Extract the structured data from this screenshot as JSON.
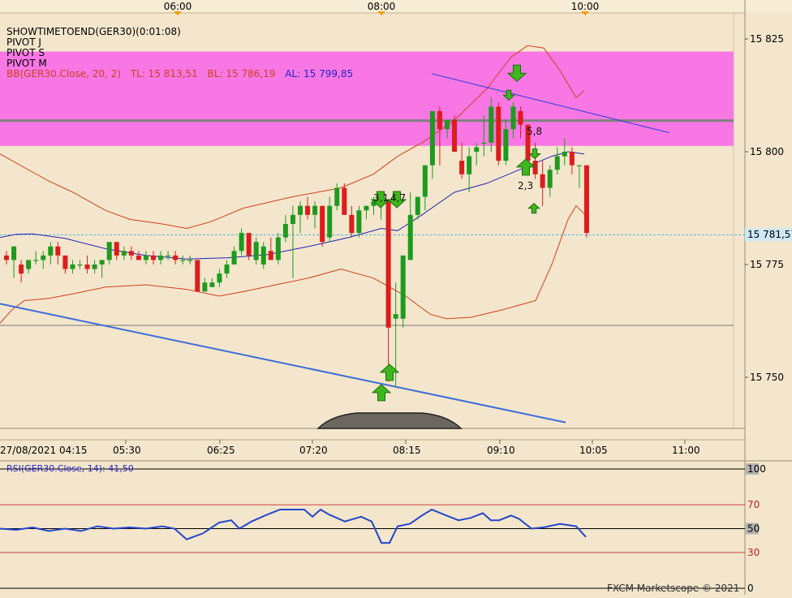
{
  "chart_data": {
    "type": "candlestick",
    "symbol": "GER30",
    "legend": [
      {
        "text": "SHOWTIMETOEND(GER30)(0:01:08)",
        "color": "#000000"
      },
      {
        "text": "PIVOT J",
        "color": "#000000"
      },
      {
        "text": "PIVOT S",
        "color": "#000000"
      },
      {
        "text": "PIVOT M",
        "color": "#000000"
      }
    ],
    "bb_legend": {
      "prefix": "BB(GER30.Close, 20, 2)",
      "tl": "TL: 15 813,51",
      "bl": "BL: 15 786,19",
      "al": "AL: 15 799,85"
    },
    "top_time_labels": [
      "06:00",
      "08:00",
      "10:00"
    ],
    "x_tick_labels": [
      "27/08/2021 04:15",
      "05:30",
      "06:25",
      "07:20",
      "08:15",
      "09:10",
      "10:05",
      "11:00"
    ],
    "y_tick_labels": [
      "15 825",
      "15 800",
      "15 775",
      "15 750"
    ],
    "y_ticks": [
      15825,
      15800,
      15775,
      15750
    ],
    "ylim": [
      15735.3,
      15832.5
    ],
    "current_price_label": "15 781,57",
    "current_price": 15781.57,
    "pivot_zone": {
      "low": 15801.3,
      "high": 15822.2,
      "line": 15806.9,
      "color": "#f877e4"
    },
    "horizontal_line": 15761.5,
    "annotations": [
      "3,1",
      "4,7",
      "5,8",
      "2,3"
    ],
    "candles": [
      [
        15777,
        15778,
        15775,
        15776
      ],
      [
        15776,
        15779,
        15772,
        15779
      ],
      [
        15775,
        15776,
        15771,
        15773
      ],
      [
        15774,
        15776,
        15773,
        15776
      ],
      [
        15776,
        15778,
        15775,
        15776
      ],
      [
        15776,
        15778,
        15774,
        15777
      ],
      [
        15777,
        15780,
        15775,
        15779
      ],
      [
        15779,
        15780,
        15775,
        15777
      ],
      [
        15777,
        15777,
        15773,
        15774
      ],
      [
        15774,
        15776,
        15773,
        15775
      ],
      [
        15775,
        15776,
        15774,
        15775
      ],
      [
        15775,
        15777,
        15773,
        15774
      ],
      [
        15774,
        15776,
        15773,
        15775
      ],
      [
        15775,
        15776,
        15772,
        15776
      ],
      [
        15776,
        15780,
        15775,
        15780
      ],
      [
        15780,
        15780,
        15776,
        15777
      ],
      [
        15777,
        15779,
        15776,
        15778
      ],
      [
        15778,
        15779,
        15776,
        15777
      ],
      [
        15777,
        15778,
        15776,
        15776
      ],
      [
        15776,
        15778,
        15775,
        15777
      ],
      [
        15777,
        15778,
        15775,
        15776
      ],
      [
        15776,
        15778,
        15775,
        15777
      ],
      [
        15777,
        15778,
        15776,
        15777
      ],
      [
        15777,
        15778,
        15775,
        15776
      ],
      [
        15776,
        15777,
        15775,
        15776
      ],
      [
        15776,
        15777,
        15775,
        15776
      ],
      [
        15776,
        15776,
        15769,
        15769
      ],
      [
        15769,
        15772,
        15769,
        15771
      ],
      [
        15770,
        15772,
        15770,
        15771
      ],
      [
        15771,
        15774,
        15770,
        15773
      ],
      [
        15773,
        15776,
        15772,
        15775
      ],
      [
        15775,
        15779,
        15775,
        15778
      ],
      [
        15778,
        15783,
        15777,
        15782
      ],
      [
        15782,
        15782,
        15776,
        15777
      ],
      [
        15776,
        15781,
        15775,
        15780
      ],
      [
        15775,
        15780,
        15774,
        15779
      ],
      [
        15778,
        15781,
        15776,
        15776
      ],
      [
        15776,
        15782,
        15775,
        15781
      ],
      [
        15781,
        15786,
        15780,
        15784
      ],
      [
        15784,
        15788,
        15772,
        15786
      ],
      [
        15786,
        15789,
        15782,
        15788
      ],
      [
        15788,
        15790,
        15785,
        15786
      ],
      [
        15786,
        15789,
        15783,
        15788
      ],
      [
        15788,
        15788,
        15779,
        15780
      ],
      [
        15781,
        15790,
        15780,
        15788
      ],
      [
        15788,
        15793,
        15787,
        15792
      ],
      [
        15792,
        15793,
        15786,
        15786
      ],
      [
        15786,
        15788,
        15781,
        15782
      ],
      [
        15782,
        15788,
        15781,
        15787
      ],
      [
        15787,
        15788,
        15785,
        15788
      ],
      [
        15788,
        15790,
        15786,
        15789
      ],
      [
        15789,
        15791,
        15785,
        15789
      ],
      [
        15789,
        15789,
        15749,
        15761
      ],
      [
        15763,
        15771,
        15748,
        15764
      ],
      [
        15763,
        15774,
        15761,
        15777
      ],
      [
        15776,
        15791,
        15776,
        15786
      ],
      [
        15786,
        15790,
        15785,
        15790
      ],
      [
        15790,
        15797,
        15787,
        15797
      ],
      [
        15797,
        15808,
        15794,
        15809
      ],
      [
        15809,
        15810,
        15797,
        15805
      ],
      [
        15805,
        15807,
        15803,
        15807
      ],
      [
        15807,
        15808,
        15800,
        15800
      ],
      [
        15798,
        15802,
        15794,
        15795
      ],
      [
        15795,
        15801,
        15791,
        15799
      ],
      [
        15800,
        15802,
        15797,
        15801
      ],
      [
        15802,
        15808,
        15799,
        15802
      ],
      [
        15802,
        15812,
        15800,
        15810
      ],
      [
        15810,
        15811,
        15797,
        15798
      ],
      [
        15798,
        15807,
        15797,
        15805
      ],
      [
        15805,
        15811,
        15803,
        15810
      ],
      [
        15809,
        15810,
        15803,
        15806
      ],
      [
        15806,
        15806,
        15797,
        15798
      ],
      [
        15798,
        15802,
        15794,
        15795
      ],
      [
        15795,
        15798,
        15788,
        15792
      ],
      [
        15792,
        15797,
        15790,
        15796
      ],
      [
        15796,
        15801,
        15795,
        15799
      ],
      [
        15799,
        15803,
        15797,
        15800
      ],
      [
        15800,
        15801,
        15795,
        15797
      ],
      [
        15797,
        15797,
        15792,
        15797
      ],
      [
        15797,
        15797,
        15781,
        15782
      ]
    ],
    "bb_middle": [
      [
        0,
        15781
      ],
      [
        20,
        15781.7
      ],
      [
        40,
        15781.8
      ],
      [
        80,
        15780.8
      ],
      [
        130,
        15778.5
      ],
      [
        180,
        15777
      ],
      [
        230,
        15776.2
      ],
      [
        280,
        15776.5
      ],
      [
        330,
        15777.2
      ],
      [
        380,
        15779
      ],
      [
        430,
        15781
      ],
      [
        470,
        15783
      ],
      [
        490,
        15782.5
      ],
      [
        520,
        15786
      ],
      [
        560,
        15791
      ],
      [
        600,
        15793
      ],
      [
        640,
        15796
      ],
      [
        680,
        15799
      ],
      [
        700,
        15800
      ],
      [
        720,
        15799.5
      ]
    ],
    "bb_upper": [
      [
        0,
        15799.5
      ],
      [
        30,
        15796.5
      ],
      [
        60,
        15793.5
      ],
      [
        90,
        15791
      ],
      [
        130,
        15787
      ],
      [
        160,
        15785
      ],
      [
        200,
        15784
      ],
      [
        230,
        15783
      ],
      [
        260,
        15784.5
      ],
      [
        300,
        15787.5
      ],
      [
        360,
        15790
      ],
      [
        420,
        15792
      ],
      [
        460,
        15795
      ],
      [
        490,
        15799
      ],
      [
        520,
        15802
      ],
      [
        560,
        15807
      ],
      [
        600,
        15814
      ],
      [
        630,
        15821
      ],
      [
        650,
        15823.5
      ],
      [
        670,
        15823
      ],
      [
        690,
        15818
      ],
      [
        710,
        15812
      ],
      [
        720,
        15813.5
      ]
    ],
    "bb_lower": [
      [
        0,
        15762
      ],
      [
        15,
        15765
      ],
      [
        30,
        15767
      ],
      [
        60,
        15767.5
      ],
      [
        90,
        15768.5
      ],
      [
        130,
        15770
      ],
      [
        180,
        15770.5
      ],
      [
        230,
        15769.5
      ],
      [
        270,
        15768
      ],
      [
        300,
        15769
      ],
      [
        340,
        15770.5
      ],
      [
        380,
        15772
      ],
      [
        420,
        15774
      ],
      [
        460,
        15772
      ],
      [
        500,
        15768
      ],
      [
        530,
        15764
      ],
      [
        550,
        15763
      ],
      [
        580,
        15763.3
      ],
      [
        620,
        15765
      ],
      [
        660,
        15767
      ],
      [
        680,
        15775
      ],
      [
        700,
        15785
      ],
      [
        710,
        15788
      ],
      [
        720,
        15786.2
      ]
    ],
    "trendline_upper": [
      [
        532,
        15817.3
      ],
      [
        825,
        15804.2
      ]
    ],
    "trendline_lower": [
      [
        0,
        15766.3
      ],
      [
        697,
        15740
      ]
    ],
    "markers": [
      {
        "dir": "down",
        "x": 469,
        "y": 15788.5,
        "size": "big"
      },
      {
        "dir": "down",
        "x": 489,
        "y": 15788.5,
        "size": "big"
      },
      {
        "dir": "down",
        "x": 637,
        "y": 15816.5,
        "size": "big"
      },
      {
        "dir": "down",
        "x": 627,
        "y": 15812,
        "size": "small"
      },
      {
        "dir": "down",
        "x": 659,
        "y": 15799,
        "size": "small"
      },
      {
        "dir": "up",
        "x": 470,
        "y": 15747.5,
        "size": "big"
      },
      {
        "dir": "up",
        "x": 480,
        "y": 15752,
        "size": "big"
      },
      {
        "dir": "up",
        "x": 648,
        "y": 15797.5,
        "size": "big"
      },
      {
        "dir": "up",
        "x": 658,
        "y": 15788,
        "size": "small"
      }
    ],
    "rsi": {
      "label": "RSI(GER30.Close, 14): 41,50",
      "ylim": [
        0,
        100
      ],
      "levels": [
        100,
        70,
        50,
        30,
        0
      ],
      "level_labels": [
        "100",
        "70",
        "50",
        "30",
        "0"
      ],
      "values": [
        [
          0,
          50
        ],
        [
          20,
          49
        ],
        [
          40,
          51
        ],
        [
          60,
          48
        ],
        [
          80,
          50
        ],
        [
          100,
          48
        ],
        [
          120,
          52
        ],
        [
          140,
          50
        ],
        [
          160,
          51
        ],
        [
          180,
          50
        ],
        [
          200,
          52
        ],
        [
          215,
          50
        ],
        [
          230,
          41
        ],
        [
          250,
          46
        ],
        [
          270,
          55
        ],
        [
          285,
          57
        ],
        [
          295,
          50
        ],
        [
          310,
          56
        ],
        [
          330,
          62
        ],
        [
          345,
          66
        ],
        [
          360,
          66
        ],
        [
          375,
          66
        ],
        [
          385,
          60
        ],
        [
          395,
          66
        ],
        [
          405,
          62
        ],
        [
          425,
          56
        ],
        [
          445,
          60
        ],
        [
          458,
          56
        ],
        [
          470,
          38
        ],
        [
          480,
          38
        ],
        [
          490,
          52
        ],
        [
          505,
          54
        ],
        [
          520,
          61
        ],
        [
          532,
          66
        ],
        [
          550,
          61
        ],
        [
          565,
          57
        ],
        [
          580,
          59
        ],
        [
          595,
          63
        ],
        [
          605,
          57
        ],
        [
          615,
          57
        ],
        [
          630,
          61
        ],
        [
          640,
          58
        ],
        [
          655,
          50
        ],
        [
          670,
          51
        ],
        [
          690,
          54
        ],
        [
          710,
          52
        ],
        [
          722,
          43
        ]
      ]
    },
    "footer": "FXCM Marketscope © 2021",
    "colors": {
      "bull": "#1e9a1e",
      "bear": "#dd1c1c",
      "bb_band": "#d0401e",
      "bb_mid": "#2323b8",
      "rsi": "#2545c9",
      "trend_upper": "#4a46d6",
      "trend_lower": "#3f6cd8",
      "marker": "#3cb81c",
      "crosshair": "#5ab4d8"
    }
  }
}
